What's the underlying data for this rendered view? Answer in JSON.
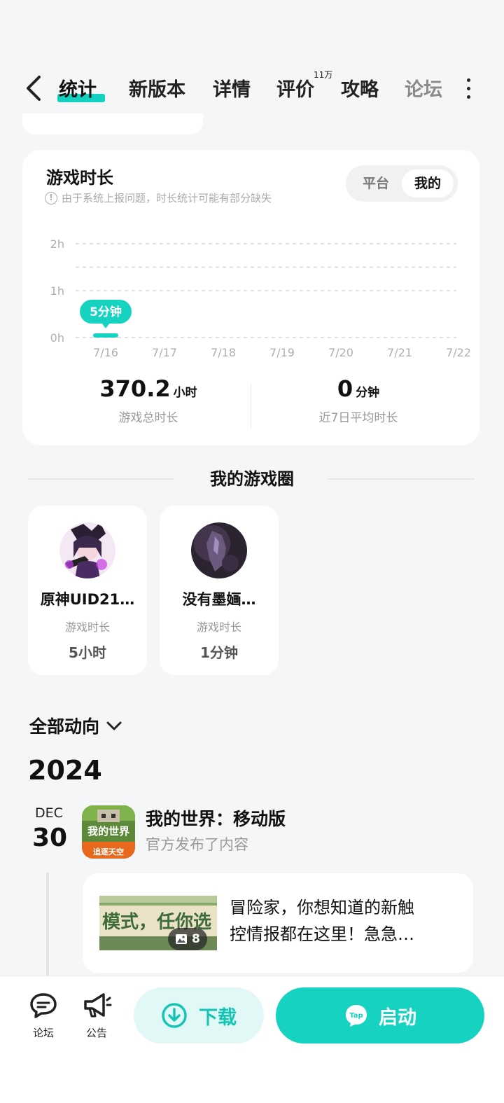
{
  "nav": {
    "tabs": [
      {
        "label": "统计"
      },
      {
        "label": "新版本"
      },
      {
        "label": "详情"
      },
      {
        "label": "评价",
        "badge": "11万"
      },
      {
        "label": "攻略"
      },
      {
        "label": "论坛"
      }
    ]
  },
  "playtime": {
    "title": "游戏时长",
    "note": "由于系统上报问题，时长统计可能有部分缺失",
    "segments": {
      "platform": "平台",
      "mine": "我的"
    },
    "total_value": "370.2",
    "total_unit": "小时",
    "total_label": "游戏总时长",
    "avg_value": "0",
    "avg_unit": "分钟",
    "avg_label": "近7日平均时长"
  },
  "chart_data": {
    "type": "bar",
    "categories": [
      "7/16",
      "7/17",
      "7/18",
      "7/19",
      "7/20",
      "7/21",
      "7/22"
    ],
    "values": [
      5,
      0,
      0,
      0,
      0,
      0,
      0
    ],
    "value_unit": "分钟",
    "y_ticks": [
      "0h",
      "1h",
      "2h"
    ],
    "ylim": [
      0,
      120
    ],
    "data_label": "5分钟",
    "accent": "#15d3c0"
  },
  "circle": {
    "title": "我的游戏圈",
    "items": [
      {
        "name": "原神UID21…",
        "label": "游戏时长",
        "value": "5小时"
      },
      {
        "name": "没有墨婳…",
        "label": "游戏时长",
        "value": "1分钟"
      }
    ]
  },
  "feed": {
    "filter": "全部动向",
    "year": "2024",
    "month": "DEC",
    "day": "30",
    "game_title": "我的世界：移动版",
    "subtitle": "官方发布了内容",
    "icon_text_top": "我的世界",
    "icon_text_bottom": "追逐天空",
    "thumb_text": "模式，任你选",
    "image_count": "8",
    "post_line1": "冒险家，你想知道的新触",
    "post_line2": "控情报都在这里！急急…"
  },
  "bottom": {
    "forum": "论坛",
    "notice": "公告",
    "download": "下载",
    "start": "启动"
  }
}
